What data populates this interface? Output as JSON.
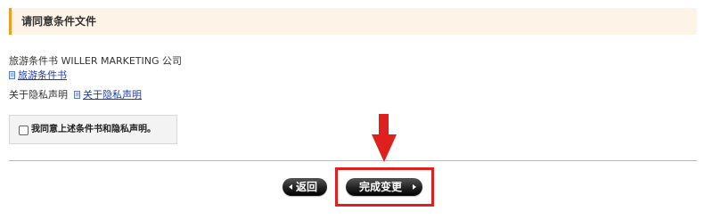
{
  "header": {
    "title": "请同意条件文件"
  },
  "terms": {
    "label": "旅游条件书 WILLER MARKETING 公司",
    "link_text": "旅游条件书",
    "link_icon": "document-icon"
  },
  "privacy": {
    "label": "关于隐私声明",
    "link_text": "关于隐私声明",
    "link_icon": "document-icon"
  },
  "agreement": {
    "checkbox_checked": false,
    "text": "我同意上述条件书和隐私声明。"
  },
  "buttons": {
    "back_label": "返回",
    "complete_label": "完成变更"
  },
  "annotation": {
    "arrow_color": "#e0201e",
    "box_color": "#e0201e"
  },
  "colors": {
    "header_bg": "#fdf3e6",
    "header_accent": "#f0a020",
    "link": "#1a3fb0"
  }
}
